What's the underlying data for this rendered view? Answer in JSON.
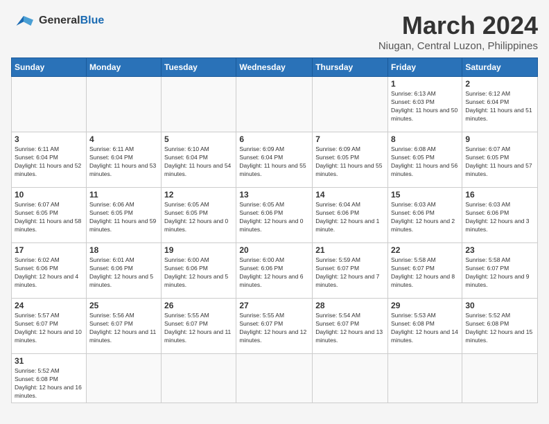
{
  "header": {
    "logo_general": "General",
    "logo_blue": "Blue",
    "title": "March 2024",
    "subtitle": "Niugan, Central Luzon, Philippines"
  },
  "days_of_week": [
    "Sunday",
    "Monday",
    "Tuesday",
    "Wednesday",
    "Thursday",
    "Friday",
    "Saturday"
  ],
  "weeks": [
    [
      {
        "day": null
      },
      {
        "day": null
      },
      {
        "day": null
      },
      {
        "day": null
      },
      {
        "day": null
      },
      {
        "day": 1,
        "sunrise": "6:13 AM",
        "sunset": "6:03 PM",
        "daylight": "11 hours and 50 minutes."
      },
      {
        "day": 2,
        "sunrise": "6:12 AM",
        "sunset": "6:04 PM",
        "daylight": "11 hours and 51 minutes."
      }
    ],
    [
      {
        "day": 3,
        "sunrise": "6:11 AM",
        "sunset": "6:04 PM",
        "daylight": "11 hours and 52 minutes."
      },
      {
        "day": 4,
        "sunrise": "6:11 AM",
        "sunset": "6:04 PM",
        "daylight": "11 hours and 53 minutes."
      },
      {
        "day": 5,
        "sunrise": "6:10 AM",
        "sunset": "6:04 PM",
        "daylight": "11 hours and 54 minutes."
      },
      {
        "day": 6,
        "sunrise": "6:09 AM",
        "sunset": "6:04 PM",
        "daylight": "11 hours and 55 minutes."
      },
      {
        "day": 7,
        "sunrise": "6:09 AM",
        "sunset": "6:05 PM",
        "daylight": "11 hours and 55 minutes."
      },
      {
        "day": 8,
        "sunrise": "6:08 AM",
        "sunset": "6:05 PM",
        "daylight": "11 hours and 56 minutes."
      },
      {
        "day": 9,
        "sunrise": "6:07 AM",
        "sunset": "6:05 PM",
        "daylight": "11 hours and 57 minutes."
      }
    ],
    [
      {
        "day": 10,
        "sunrise": "6:07 AM",
        "sunset": "6:05 PM",
        "daylight": "11 hours and 58 minutes."
      },
      {
        "day": 11,
        "sunrise": "6:06 AM",
        "sunset": "6:05 PM",
        "daylight": "11 hours and 59 minutes."
      },
      {
        "day": 12,
        "sunrise": "6:05 AM",
        "sunset": "6:05 PM",
        "daylight": "12 hours and 0 minutes."
      },
      {
        "day": 13,
        "sunrise": "6:05 AM",
        "sunset": "6:06 PM",
        "daylight": "12 hours and 0 minutes."
      },
      {
        "day": 14,
        "sunrise": "6:04 AM",
        "sunset": "6:06 PM",
        "daylight": "12 hours and 1 minute."
      },
      {
        "day": 15,
        "sunrise": "6:03 AM",
        "sunset": "6:06 PM",
        "daylight": "12 hours and 2 minutes."
      },
      {
        "day": 16,
        "sunrise": "6:03 AM",
        "sunset": "6:06 PM",
        "daylight": "12 hours and 3 minutes."
      }
    ],
    [
      {
        "day": 17,
        "sunrise": "6:02 AM",
        "sunset": "6:06 PM",
        "daylight": "12 hours and 4 minutes."
      },
      {
        "day": 18,
        "sunrise": "6:01 AM",
        "sunset": "6:06 PM",
        "daylight": "12 hours and 5 minutes."
      },
      {
        "day": 19,
        "sunrise": "6:00 AM",
        "sunset": "6:06 PM",
        "daylight": "12 hours and 5 minutes."
      },
      {
        "day": 20,
        "sunrise": "6:00 AM",
        "sunset": "6:06 PM",
        "daylight": "12 hours and 6 minutes."
      },
      {
        "day": 21,
        "sunrise": "5:59 AM",
        "sunset": "6:07 PM",
        "daylight": "12 hours and 7 minutes."
      },
      {
        "day": 22,
        "sunrise": "5:58 AM",
        "sunset": "6:07 PM",
        "daylight": "12 hours and 8 minutes."
      },
      {
        "day": 23,
        "sunrise": "5:58 AM",
        "sunset": "6:07 PM",
        "daylight": "12 hours and 9 minutes."
      }
    ],
    [
      {
        "day": 24,
        "sunrise": "5:57 AM",
        "sunset": "6:07 PM",
        "daylight": "12 hours and 10 minutes."
      },
      {
        "day": 25,
        "sunrise": "5:56 AM",
        "sunset": "6:07 PM",
        "daylight": "12 hours and 11 minutes."
      },
      {
        "day": 26,
        "sunrise": "5:55 AM",
        "sunset": "6:07 PM",
        "daylight": "12 hours and 11 minutes."
      },
      {
        "day": 27,
        "sunrise": "5:55 AM",
        "sunset": "6:07 PM",
        "daylight": "12 hours and 12 minutes."
      },
      {
        "day": 28,
        "sunrise": "5:54 AM",
        "sunset": "6:07 PM",
        "daylight": "12 hours and 13 minutes."
      },
      {
        "day": 29,
        "sunrise": "5:53 AM",
        "sunset": "6:08 PM",
        "daylight": "12 hours and 14 minutes."
      },
      {
        "day": 30,
        "sunrise": "5:52 AM",
        "sunset": "6:08 PM",
        "daylight": "12 hours and 15 minutes."
      }
    ],
    [
      {
        "day": 31,
        "sunrise": "5:52 AM",
        "sunset": "6:08 PM",
        "daylight": "12 hours and 16 minutes."
      },
      {
        "day": null
      },
      {
        "day": null
      },
      {
        "day": null
      },
      {
        "day": null
      },
      {
        "day": null
      },
      {
        "day": null
      }
    ]
  ]
}
